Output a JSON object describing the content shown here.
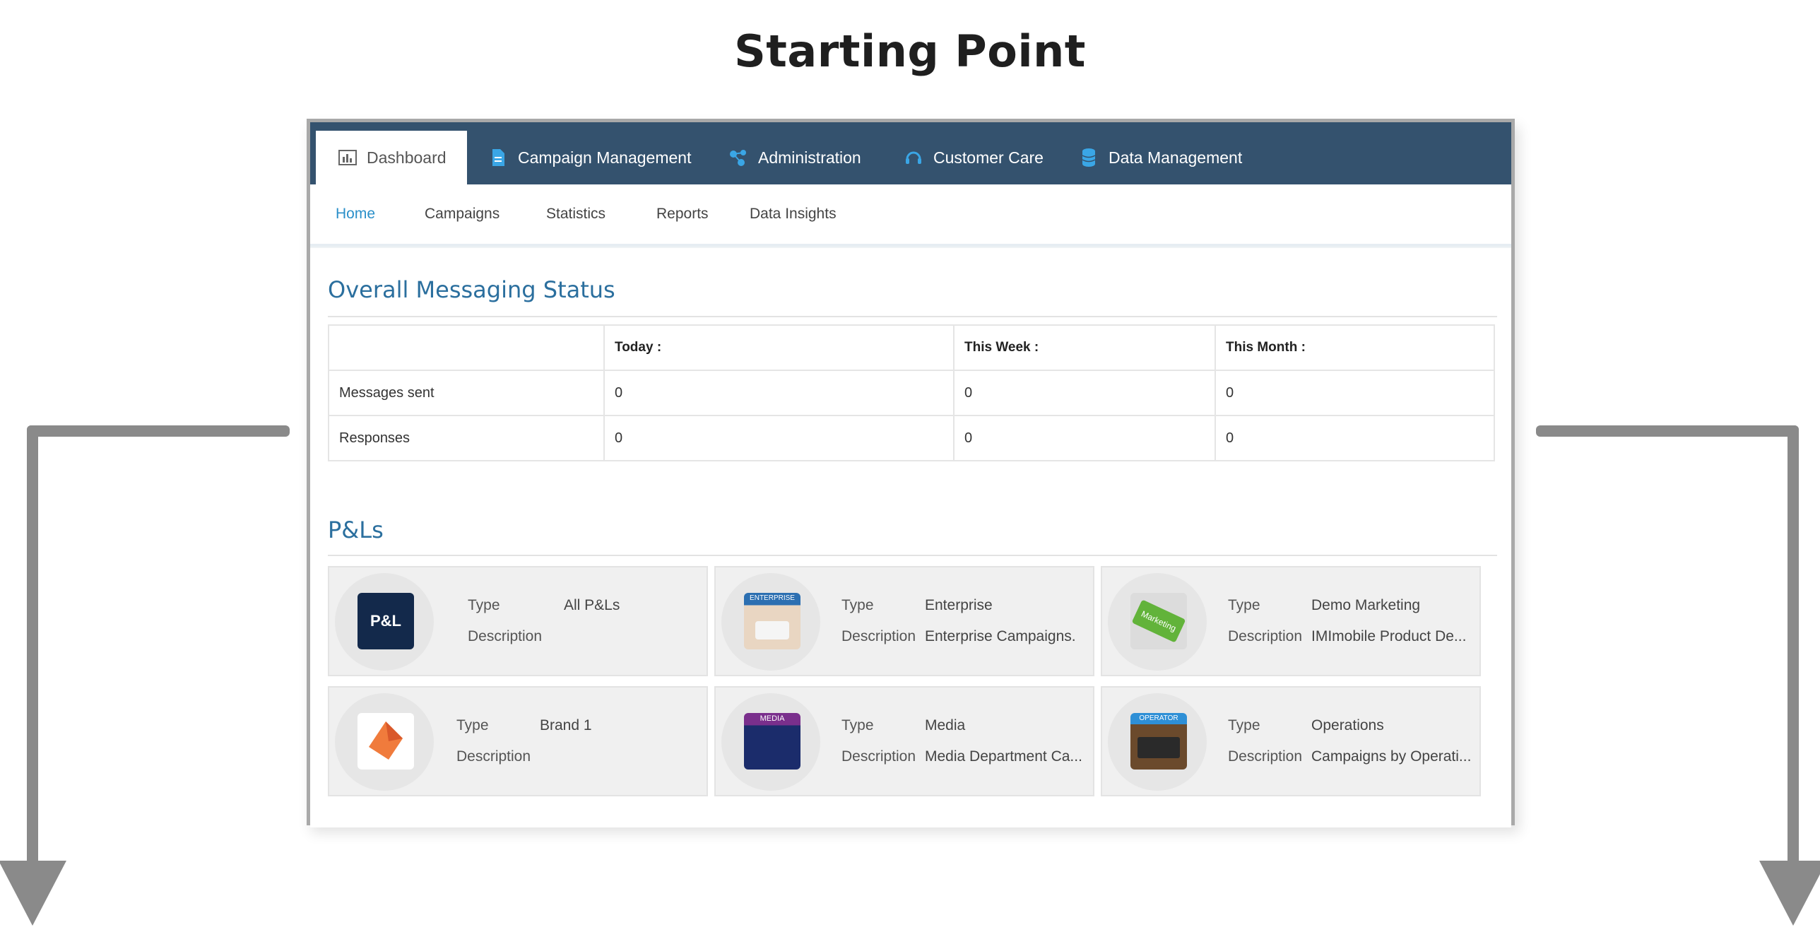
{
  "heading": "Starting Point",
  "top_nav": {
    "tabs": [
      {
        "label": "Dashboard",
        "icon": "bar-chart-icon",
        "active": true
      },
      {
        "label": "Campaign Management",
        "icon": "document-icon"
      },
      {
        "label": "Administration",
        "icon": "network-icon"
      },
      {
        "label": "Customer Care",
        "icon": "headset-icon"
      },
      {
        "label": "Data Management",
        "icon": "database-icon"
      }
    ]
  },
  "sub_nav": {
    "tabs": [
      {
        "label": "Home",
        "active": true
      },
      {
        "label": "Campaigns"
      },
      {
        "label": "Statistics"
      },
      {
        "label": "Reports"
      },
      {
        "label": "Data Insights"
      }
    ]
  },
  "status": {
    "title": "Overall Messaging Status",
    "columns": [
      "",
      "Today :",
      "This Week :",
      "This Month :"
    ],
    "rows": [
      {
        "label": "Messages sent",
        "today": "0",
        "week": "0",
        "month": "0"
      },
      {
        "label": "Responses",
        "today": "0",
        "week": "0",
        "month": "0"
      }
    ]
  },
  "pls": {
    "title": "P&Ls",
    "type_label": "Type",
    "description_label": "Description",
    "cards": [
      {
        "type": "All P&Ls",
        "description": "",
        "thumb_text": "P&L"
      },
      {
        "type": "Enterprise",
        "description": "Enterprise Campaigns.",
        "thumb_text": "ENTERPRISE"
      },
      {
        "type": "Demo Marketing",
        "description": "IMImobile Product De...",
        "thumb_text": "Marketing"
      },
      {
        "type": "Brand 1",
        "description": "",
        "thumb_text": ""
      },
      {
        "type": "Media",
        "description": "Media Department Ca...",
        "thumb_text": "MEDIA"
      },
      {
        "type": "Operations",
        "description": "Campaigns by Operati...",
        "thumb_text": "OPERATOR"
      }
    ]
  },
  "colors": {
    "nav_bg": "#34526e",
    "accent": "#2a8fc9",
    "section_title": "#2b6f9e",
    "arrow": "#8a8a8a"
  }
}
